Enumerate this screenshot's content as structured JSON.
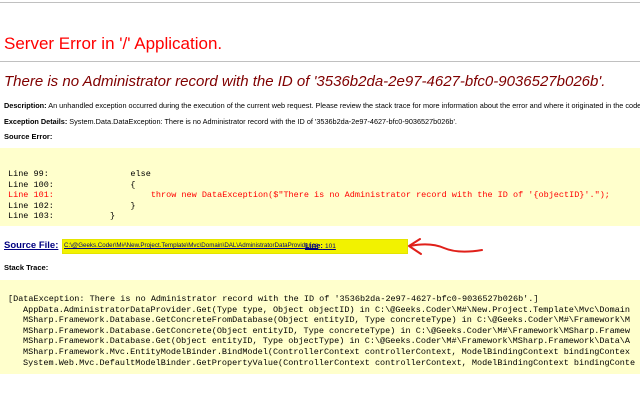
{
  "title": "Server Error in '/' Application.",
  "message": "There is no Administrator record with the ID of '3536b2da-2e97-4627-bfc0-9036527b026b'.",
  "description": {
    "label": "Description:",
    "text": "An unhandled exception occurred during the execution of the current web request. Please review the stack trace for more information about the error and where it originated in the code."
  },
  "exception_details": {
    "label": "Exception Details:",
    "text": "System.Data.DataException: There is no Administrator record with the ID of '3536b2da-2e97-4627-bfc0-9036527b026b'."
  },
  "source_error": {
    "heading": "Source Error:",
    "lines": [
      "Line 99:                else",
      "Line 100:               {",
      "Line 101:                   throw new DataException($\"There is no Administrator record with the ID of '{objectID}'.\");",
      "Line 102:               }",
      "Line 103:           }"
    ],
    "error_line_index": 2
  },
  "source_file": {
    "label": "Source File:",
    "path": "C:\\@Geeks.Coder\\M#\\New.Project.Template\\Mvc\\Domain\\DAL\\AdministratorDataProvider.cs",
    "line_label": "Line:",
    "line_number": "101"
  },
  "stack_trace": {
    "heading": "Stack Trace:",
    "lines": [
      "[DataException: There is no Administrator record with the ID of '3536b2da-2e97-4627-bfc0-9036527b026b'.]",
      "AppData.AdministratorDataProvider.Get(Type type, Object objectID) in C:\\@Geeks.Coder\\M#\\New.Project.Template\\Mvc\\Domain",
      "MSharp.Framework.Database.GetConcreteFromDatabase(Object entityID, Type concreteType) in C:\\@Geeks.Coder\\M#\\Framework\\M",
      "MSharp.Framework.Database.GetConcrete(Object entityID, Type concreteType) in C:\\@Geeks.Coder\\M#\\Framework\\MSharp.Framew",
      "MSharp.Framework.Database.Get(Object entityID, Type objectType) in C:\\@Geeks.Coder\\M#\\Framework\\MSharp.Framework\\Data\\A",
      "MSharp.Framework.Mvc.EntityModelBinder.BindModel(ControllerContext controllerContext, ModelBindingContext bindingContex",
      "System.Web.Mvc.DefaultModelBinder.GetPropertyValue(ControllerContext controllerContext, ModelBindingContext bindingConte"
    ]
  },
  "colors": {
    "title": "#ff0000",
    "message": "#800000",
    "code_background": "#ffffcc",
    "highlight": "#f2f200",
    "annotation_arrow": "#e0201a",
    "link": "#000080"
  },
  "icons": {
    "annotation": "hand-drawn-arrow-icon"
  }
}
